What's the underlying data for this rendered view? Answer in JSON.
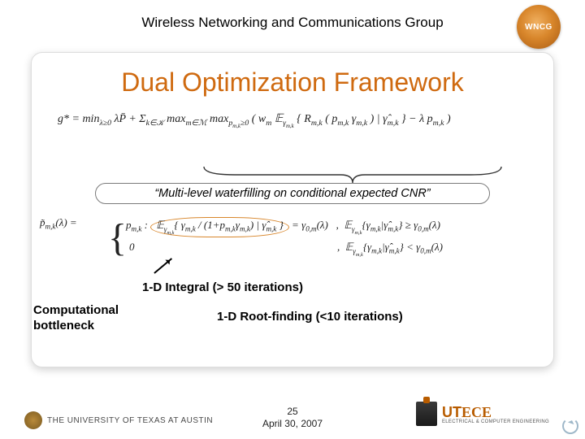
{
  "header": {
    "group_name": "Wireless Networking and Communications Group",
    "logo_text": "WNCG"
  },
  "slide": {
    "title": "Dual Optimization Framework",
    "equation_main": "g* = min_{λ≥0} λP̄ + Σ_{k∈𝒦} max_{m∈ℳ} max_{p_{m,k}≥0} ( w_m 𝔼_{γ_{m,k}} { R_{m,k} ( p_{m,k} γ_{m,k} ) | γ̂_{m,k} } − λ p_{m,k} )",
    "quote": "“Multi-level waterfilling on conditional expected CNR”",
    "equation_piecewise_lhs": "p̃_{m,k}(λ) =",
    "equation_piecewise_row1": "p_{m,k} : 𝔼_{γ_{m,k}} { γ_{m,k} / (1 + p_{m,k} γ_{m,k}) | γ̂_{m,k} } = γ_{0,m}(λ)",
    "equation_piecewise_row1_cond": ", 𝔼_{γ_{m,k}} { γ_{m,k} | γ̂_{m,k} } ≥ γ_{0,m}(λ)",
    "equation_piecewise_row2": "0",
    "equation_piecewise_row2_cond": ", 𝔼_{γ_{m,k}} { γ_{m,k} | γ̂_{m,k} } < γ_{0,m}(λ)",
    "annot_integral": "1-D  Integral (> 50 iterations)",
    "annot_bottleneck": "Computational\nbottleneck",
    "annot_rootfind": "1-D Root-finding (<10 iterations)"
  },
  "footer": {
    "page_number": "25",
    "date": "April 30, 2007",
    "ut_austin": "THE UNIVERSITY OF TEXAS AT AUSTIN",
    "utece_main": "UT",
    "utece_ece": "ECE",
    "utece_sub": "ELECTRICAL & COMPUTER ENGINEERING"
  }
}
